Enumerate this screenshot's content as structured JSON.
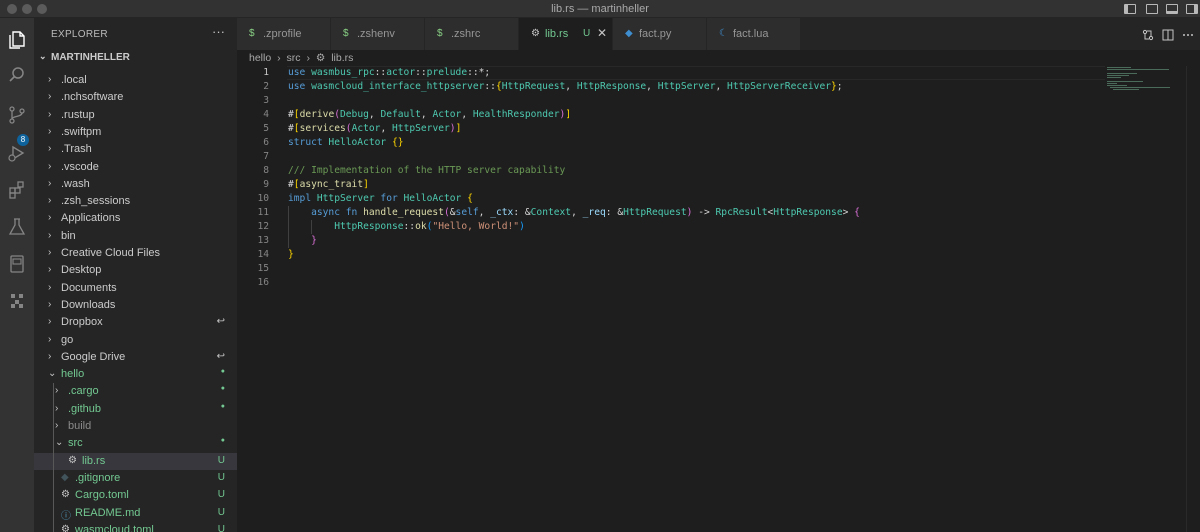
{
  "window": {
    "title": "lib.rs — martinheller"
  },
  "activity_bar": {
    "source_control_badge": "8"
  },
  "sidebar": {
    "header": "EXPLORER",
    "more_actions": "···",
    "root_label": "MARTINHELLER",
    "items": [
      {
        "label": ".local",
        "chevron": "›",
        "decoration": ""
      },
      {
        "label": ".nchsoftware",
        "chevron": "›",
        "decoration": ""
      },
      {
        "label": ".rustup",
        "chevron": "›",
        "decoration": ""
      },
      {
        "label": ".swiftpm",
        "chevron": "›",
        "decoration": ""
      },
      {
        "label": ".Trash",
        "chevron": "›",
        "decoration": ""
      },
      {
        "label": ".vscode",
        "chevron": "›",
        "decoration": ""
      },
      {
        "label": ".wash",
        "chevron": "›",
        "decoration": ""
      },
      {
        "label": ".zsh_sessions",
        "chevron": "›",
        "decoration": ""
      },
      {
        "label": "Applications",
        "chevron": "›",
        "decoration": ""
      },
      {
        "label": "bin",
        "chevron": "›",
        "decoration": ""
      },
      {
        "label": "Creative Cloud Files",
        "chevron": "›",
        "decoration": ""
      },
      {
        "label": "Desktop",
        "chevron": "›",
        "decoration": ""
      },
      {
        "label": "Documents",
        "chevron": "›",
        "decoration": ""
      },
      {
        "label": "Downloads",
        "chevron": "›",
        "decoration": ""
      },
      {
        "label": "Dropbox",
        "chevron": "›",
        "decoration": "↩"
      },
      {
        "label": "go",
        "chevron": "›",
        "decoration": ""
      },
      {
        "label": "Google Drive",
        "chevron": "›",
        "decoration": "↩"
      },
      {
        "label": "hello",
        "chevron": "⌄",
        "decoration": "●"
      },
      {
        "label": ".cargo",
        "chevron": "›",
        "decoration": "●"
      },
      {
        "label": ".github",
        "chevron": "›",
        "decoration": "●"
      },
      {
        "label": "build",
        "chevron": "›",
        "decoration": ""
      },
      {
        "label": "src",
        "chevron": "⌄",
        "decoration": "●"
      },
      {
        "label": "lib.rs",
        "chevron": "",
        "decoration": "U"
      },
      {
        "label": ".gitignore",
        "chevron": "",
        "decoration": "U"
      },
      {
        "label": "Cargo.toml",
        "chevron": "",
        "decoration": "U"
      },
      {
        "label": "README.md",
        "chevron": "",
        "decoration": "U"
      },
      {
        "label": "wasmcloud.toml",
        "chevron": "",
        "decoration": "U"
      }
    ]
  },
  "tabs": [
    {
      "label": ".zprofile",
      "icon": "$",
      "active": false
    },
    {
      "label": ".zshenv",
      "icon": "$",
      "active": false
    },
    {
      "label": ".zshrc",
      "icon": "$",
      "active": false
    },
    {
      "label": "lib.rs",
      "icon": "⚙",
      "active": true,
      "decoration": "U",
      "close": "✕"
    },
    {
      "label": "fact.py",
      "icon": "◆",
      "active": false
    },
    {
      "label": "fact.lua",
      "icon": "☾",
      "active": false
    }
  ],
  "breadcrumb": [
    "hello",
    "›",
    "src",
    "›",
    "⚙",
    "lib.rs"
  ],
  "editor": {
    "line_numbers": [
      "1",
      "2",
      "3",
      "4",
      "5",
      "6",
      "7",
      "8",
      "9",
      "10",
      "11",
      "12",
      "13",
      "14",
      "15",
      "16"
    ],
    "code": {
      "l1_use": "use",
      "l1_path": "wasmbus_rpc",
      "l1_sep1": "::",
      "l1_actor": "actor",
      "l1_sep2": "::",
      "l1_prelude": "prelude",
      "l1_tail": "::*;",
      "l2_use": "use",
      "l2_path": "wasmcloud_interface_httpserver",
      "l2_sep": "::",
      "l2_open": "{",
      "l2_t1": "HttpRequest",
      "l2_c1": ", ",
      "l2_t2": "HttpResponse",
      "l2_c2": ", ",
      "l2_t3": "HttpServer",
      "l2_c3": ", ",
      "l2_t4": "HttpServerReceiver",
      "l2_close": "}",
      "l2_semi": ";",
      "l4_hash": "#",
      "l4_open": "[",
      "l4_derive": "derive",
      "l4_p1": "(",
      "l4_a": "Debug",
      "l4_c1": ", ",
      "l4_b": "Default",
      "l4_c2": ", ",
      "l4_c": "Actor",
      "l4_c3": ", ",
      "l4_d": "HealthResponder",
      "l4_p2": ")",
      "l4_close": "]",
      "l5_hash": "#",
      "l5_open": "[",
      "l5_services": "services",
      "l5_p1": "(",
      "l5_a": "Actor",
      "l5_c1": ", ",
      "l5_b": "HttpServer",
      "l5_p2": ")",
      "l5_close": "]",
      "l6_struct": "struct",
      "l6_name": " HelloActor ",
      "l6_braces": "{}",
      "l8_comment": "/// Implementation of the HTTP server capability",
      "l9_hash": "#",
      "l9_open": "[",
      "l9_attr": "async_trait",
      "l9_close": "]",
      "l10_impl": "impl",
      "l10_trait": " HttpServer ",
      "l10_for": "for",
      "l10_type": " HelloActor ",
      "l10_brace": "{",
      "l11_async": "async",
      "l11_fn": " fn ",
      "l11_name": "handle_request",
      "l11_p1": "(",
      "l11_amp": "&",
      "l11_self": "self",
      "l11_c1": ", ",
      "l11_ctx": "_ctx",
      "l11_colon1": ": &",
      "l11_ctxty": "Context",
      "l11_c2": ", ",
      "l11_req": "_req",
      "l11_colon2": ": &",
      "l11_reqty": "HttpRequest",
      "l11_p2": ")",
      "l11_arrow": " -> ",
      "l11_ret": "RpcResult",
      "l11_lt": "<",
      "l11_retinner": "HttpResponse",
      "l11_gt": ">",
      "l11_brace": " {",
      "l12_type": "HttpResponse",
      "l12_sep": "::",
      "l12_fn": "ok",
      "l12_p1": "(",
      "l12_str": "\"Hello, World!\"",
      "l12_p2": ")",
      "l13_brace": "}",
      "l14_brace": "}"
    }
  },
  "colors": {
    "accent": "#0e639c",
    "untracked": "#73c991",
    "editor_bg": "#1e1e1e",
    "sidebar_bg": "#252526"
  }
}
